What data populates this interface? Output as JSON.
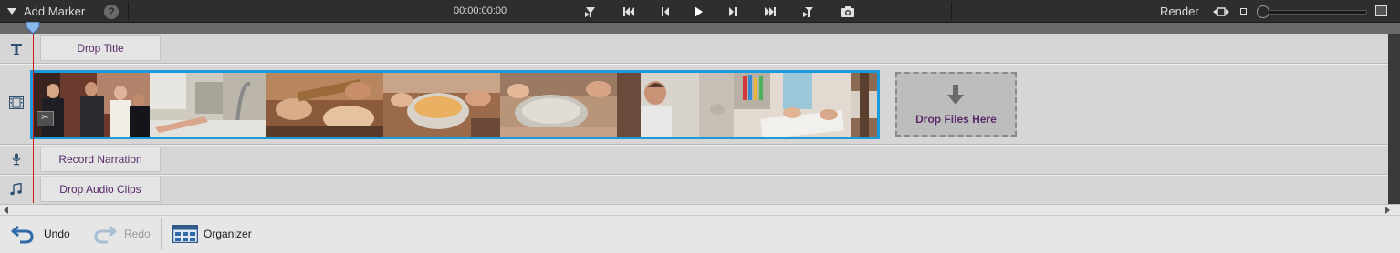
{
  "toolbar": {
    "add_marker_label": "Add Marker",
    "help_label": "?",
    "timecode": "00:00:00:00",
    "render_label": "Render",
    "buttons": [
      "go-to-previous-marker-icon",
      "skip-to-start-icon",
      "step-back-icon",
      "play-icon",
      "step-forward-icon",
      "skip-to-end-icon",
      "go-to-next-marker-icon",
      "camera-snapshot-icon"
    ],
    "zoom_level": 0.0
  },
  "tracks": {
    "title": {
      "icon": "text-title-icon",
      "label": "Drop Title"
    },
    "video": {
      "icon": "film-strip-icon",
      "drop_files_label": "Drop Files Here"
    },
    "narration": {
      "icon": "microphone-icon",
      "label": "Record Narration"
    },
    "audio": {
      "icon": "music-note-icon",
      "label": "Drop Audio Clips"
    }
  },
  "clip": {
    "selected": true,
    "accent": "#1a9ad8",
    "frames": [
      "party-guests",
      "kitchen-faucet",
      "kids-baking",
      "mixing-bowl",
      "rolling-dough",
      "smiling-boy",
      "drawing-crayons",
      "partial-frame"
    ]
  },
  "bottombar": {
    "undo_label": "Undo",
    "redo_label": "Redo",
    "organizer_label": "Organizer"
  },
  "colors": {
    "label_text": "#5a2a6a",
    "playhead": "#d21b1b"
  }
}
